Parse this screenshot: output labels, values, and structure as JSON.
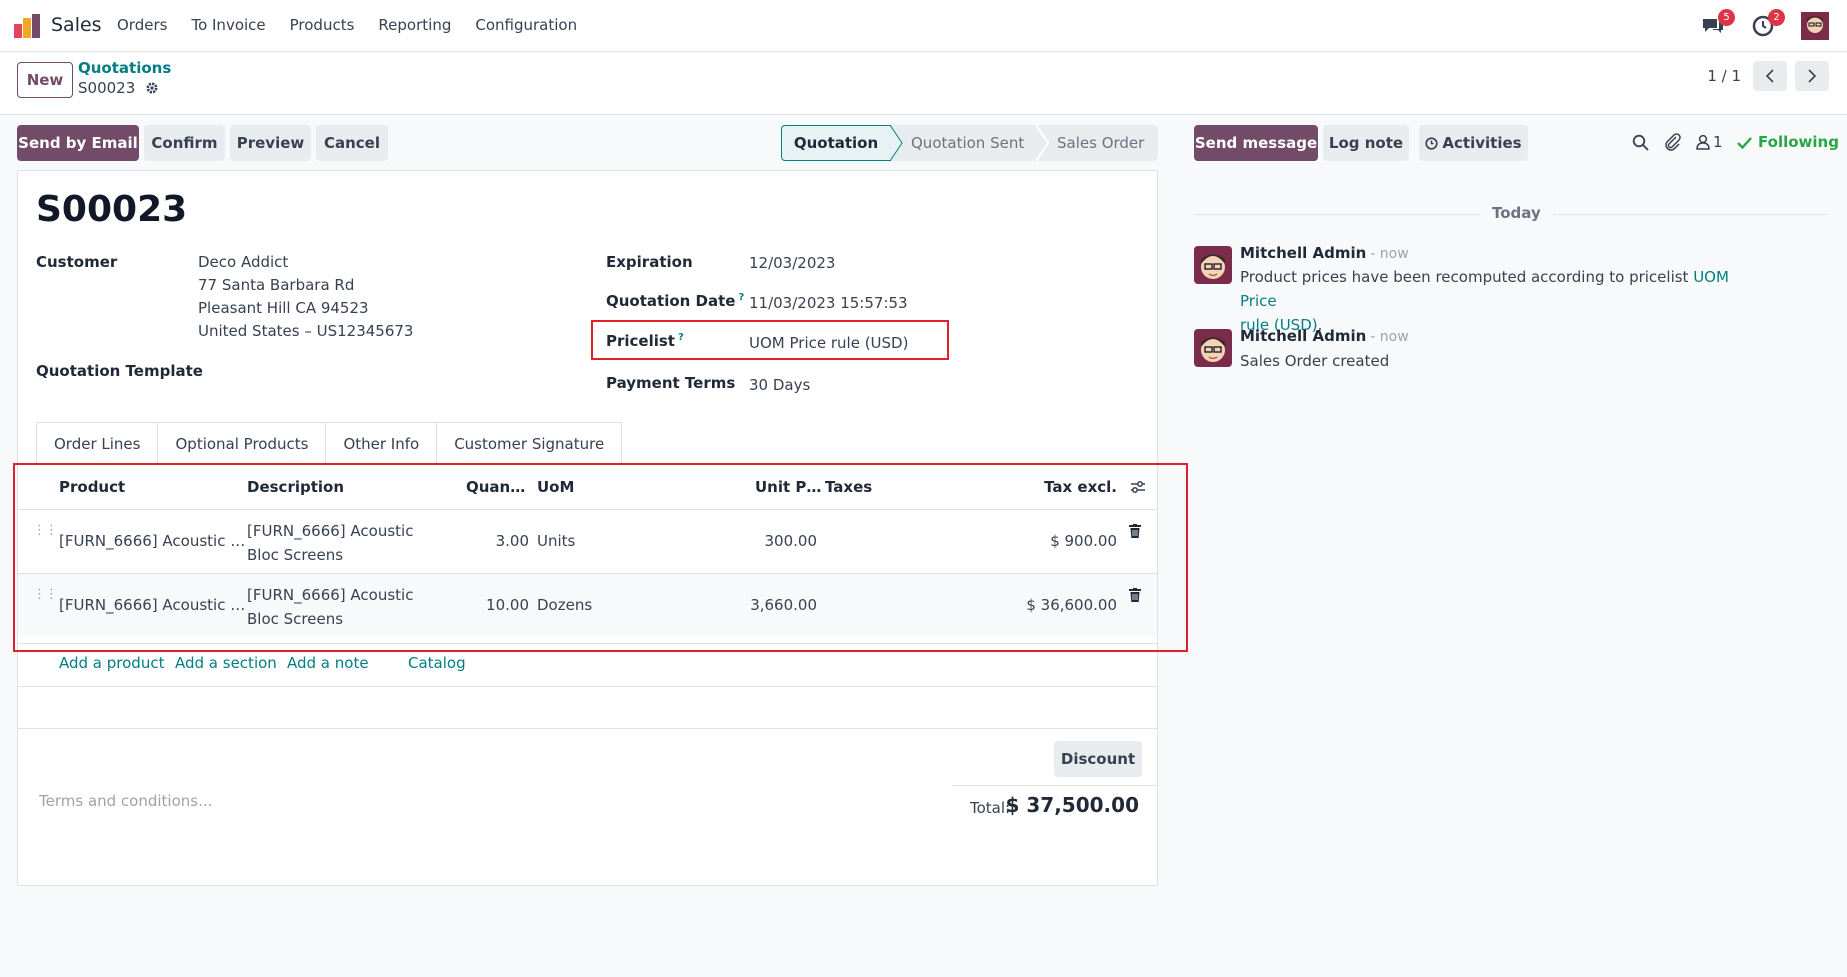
{
  "topbar": {
    "app_name": "Sales",
    "menu": [
      "Orders",
      "To Invoice",
      "Products",
      "Reporting",
      "Configuration"
    ],
    "messages_count": "5",
    "activities_count": "2"
  },
  "control_panel": {
    "new_label": "New",
    "breadcrumb_parent": "Quotations",
    "breadcrumb_current": "S00023",
    "pager": "1 / 1"
  },
  "actions": {
    "send_by_email": "Send by Email",
    "confirm": "Confirm",
    "preview": "Preview",
    "cancel": "Cancel"
  },
  "statusbar": {
    "stages": [
      "Quotation",
      "Quotation Sent",
      "Sales Order"
    ],
    "active": "Quotation"
  },
  "form": {
    "title": "S00023",
    "customer_label": "Customer",
    "customer_name": "Deco Addict",
    "customer_addr1": "77 Santa Barbara Rd",
    "customer_addr2": "Pleasant Hill CA 94523",
    "customer_addr3": "United States – US12345673",
    "quotation_template_label": "Quotation Template",
    "expiration_label": "Expiration",
    "expiration": "12/03/2023",
    "quotation_date_label": "Quotation Date",
    "quotation_date": "11/03/2023 15:57:53",
    "pricelist_label": "Pricelist",
    "pricelist": "UOM Price rule (USD)",
    "payment_terms_label": "Payment Terms",
    "payment_terms": "30 Days",
    "help_mark": "?"
  },
  "tabs": [
    "Order Lines",
    "Optional Products",
    "Other Info",
    "Customer Signature"
  ],
  "order_lines": {
    "columns": {
      "product": "Product",
      "description": "Description",
      "quantity": "Quan…",
      "uom": "UoM",
      "unit_price": "Unit P…",
      "taxes": "Taxes",
      "tax_excl": "Tax excl."
    },
    "rows": [
      {
        "product": "[FURN_6666] Acoustic …",
        "description_line1": "[FURN_6666] Acoustic",
        "description_line2": "Bloc Screens",
        "quantity": "3.00",
        "uom": "Units",
        "unit_price": "300.00",
        "taxes": "",
        "subtotal": "$ 900.00"
      },
      {
        "product": "[FURN_6666] Acoustic …",
        "description_line1": "[FURN_6666] Acoustic",
        "description_line2": "Bloc Screens",
        "quantity": "10.00",
        "uom": "Dozens",
        "unit_price": "3,660.00",
        "taxes": "",
        "subtotal": "$ 36,600.00"
      }
    ],
    "add_product": "Add a product",
    "add_section": "Add a section",
    "add_note": "Add a note",
    "catalog": "Catalog"
  },
  "footer": {
    "discount": "Discount",
    "terms_placeholder": "Terms and conditions...",
    "total_label": "Total:",
    "total_value": "$ 37,500.00"
  },
  "chatter": {
    "send_message": "Send message",
    "log_note": "Log note",
    "activities": "Activities",
    "followers_count": "1",
    "following": "Following",
    "today": "Today",
    "messages": [
      {
        "author": "Mitchell Admin",
        "time": "- now",
        "body_prefix": "Product prices have been recomputed according to pricelist ",
        "body_link_1": "UOM Price",
        "body_link_2": "rule (USD)",
        "body_suffix": "."
      },
      {
        "author": "Mitchell Admin",
        "time": "- now",
        "body": "Sales Order created"
      }
    ]
  },
  "colors": {
    "brand": "#714b67",
    "link": "#017e84",
    "highlight": "#e0212b"
  }
}
